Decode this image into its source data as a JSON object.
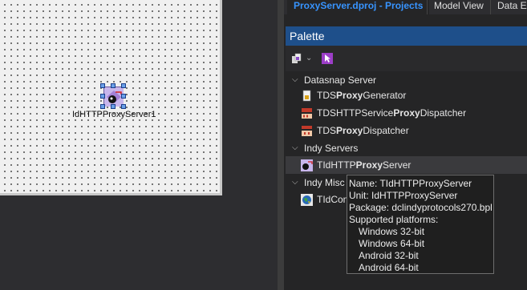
{
  "tabs": [
    {
      "label": "ProxyServer.dproj - Projects",
      "active": true
    },
    {
      "label": "Model View",
      "active": false
    },
    {
      "label": "Data Ex",
      "active": false
    }
  ],
  "designer": {
    "component_label": "IdHTTPProxyServer1"
  },
  "palette": {
    "title": "Palette",
    "categories": [
      {
        "name": "Datasnap Server",
        "items": [
          {
            "prefix": "TDS",
            "bold": "Proxy",
            "suffix": "Generator",
            "icon": "proxy-generator-icon"
          },
          {
            "prefix": "TDSHTTPService",
            "bold": "Proxy",
            "suffix": "Dispatcher",
            "icon": "http-service-proxy-dispatcher-icon"
          },
          {
            "prefix": "TDS",
            "bold": "Proxy",
            "suffix": "Dispatcher",
            "icon": "proxy-dispatcher-icon"
          }
        ]
      },
      {
        "name": "Indy Servers",
        "items": [
          {
            "prefix": "TIdHTTP",
            "bold": "Proxy",
            "suffix": "Server",
            "icon": "http-proxy-server-icon",
            "selected": true
          }
        ]
      },
      {
        "name": "Indy Misc",
        "items": [
          {
            "prefix": "TIdCon",
            "bold": "",
            "suffix": "",
            "icon": "globe-icon"
          }
        ]
      }
    ]
  },
  "tooltip": {
    "name": "Name: TIdHTTPProxyServer",
    "unit": "Unit: IdHTTPProxyServer",
    "package": "Package: dclindyprotocols270.bpl",
    "platforms_label": "Supported platforms:",
    "platforms": [
      "Windows 32-bit",
      "Windows 64-bit",
      "Android 32-bit",
      "Android 64-bit"
    ]
  },
  "colors": {
    "accent_tab": "#3794ff",
    "palette_header": "#1e4f8a",
    "panel_bg": "#252526"
  }
}
